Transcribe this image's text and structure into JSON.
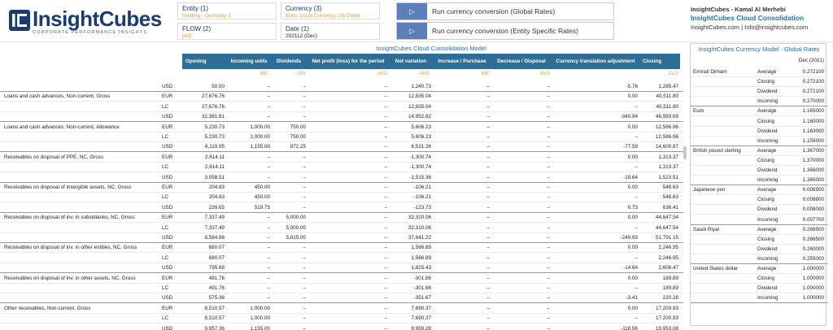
{
  "logo": {
    "main": "InsightCubes",
    "sub": "CORPORATE PERFORMANCE INSIGHTS"
  },
  "filters": [
    {
      "title": "Entity (1)",
      "value": "Holding - Germany 1"
    },
    {
      "title": "Currency (3)",
      "value": "Euro, Local Currency, US Dollar"
    },
    {
      "title": "FLOW (2)",
      "value": "[All]"
    },
    {
      "title": "Date (1)",
      "value": "202112 (Dec)"
    }
  ],
  "buttons": [
    {
      "label": "Run currency conversion (Global Rates)"
    },
    {
      "label": "Run currency conversion (Entity Specific Rates)"
    }
  ],
  "info": {
    "line1": "InsightCubes - Kamal Al Merhebi",
    "line2": "InsightCubes Cloud Consolidation",
    "line3": "InsightCubes.com | Info@insightcubes.com"
  },
  "main": {
    "title": "InsightCubes Cloud Consolidation Model",
    "columns": [
      "Opening",
      "Incoming units",
      "Dividends",
      "Net profit (loss) for the period",
      "Net variation",
      "Increase / Purchase",
      "Decrease / Disposal",
      "Currency translation adjustment",
      "Closing"
    ],
    "operators": [
      "",
      "INC",
      "DIV",
      "AVG",
      "AVG",
      "INC",
      "AVG",
      "",
      "CLO"
    ],
    "rows": [
      {
        "label": "",
        "cur": "USD",
        "v": [
          "50.50",
          "–",
          "–",
          "–",
          "1,240.73",
          "–",
          "–",
          "-5.76",
          "1,285.47"
        ]
      },
      {
        "label": "Loans and cash advances, Non-current, Gross",
        "cur": "EUR",
        "v": [
          "27,676.76",
          "–",
          "–",
          "–",
          "12,835.04",
          "–",
          "–",
          "0.00",
          "40,511.80"
        ]
      },
      {
        "label": "",
        "cur": "LC",
        "v": [
          "27,676.76",
          "–",
          "–",
          "–",
          "12,835.04",
          "–",
          "–",
          "–",
          "40,511.80"
        ]
      },
      {
        "label": "",
        "cur": "USD",
        "v": [
          "32,381.81",
          "–",
          "–",
          "–",
          "14,952.82",
          "–",
          "–",
          "-340.94",
          "46,993.69"
        ]
      },
      {
        "label": "Loans and cash advances, Non-current, Allowance",
        "cur": "EUR",
        "v": [
          "5,230.73",
          "1,000.00",
          "750.00",
          "–",
          "5,606.23",
          "–",
          "–",
          "0.00",
          "12,586.96"
        ]
      },
      {
        "label": "",
        "cur": "LC",
        "v": [
          "5,230.73",
          "1,000.00",
          "750.00",
          "–",
          "5,606.23",
          "–",
          "–",
          "–",
          "12,586.96"
        ]
      },
      {
        "label": "",
        "cur": "USD",
        "v": [
          "6,119.95",
          "1,155.00",
          "872.25",
          "–",
          "6,531.26",
          "–",
          "–",
          "-77.59",
          "14,600.87"
        ]
      },
      {
        "label": "Receivables on disposal of PPE, NC, Gross",
        "cur": "EUR",
        "v": [
          "2,614.11",
          "–",
          "–",
          "–",
          "-1,300.74",
          "–",
          "–",
          "0.00",
          "1,313.37"
        ]
      },
      {
        "label": "",
        "cur": "LC",
        "v": [
          "2,614.11",
          "–",
          "–",
          "–",
          "-1,300.74",
          "–",
          "–",
          "–",
          "1,313.37"
        ]
      },
      {
        "label": "",
        "cur": "USD",
        "v": [
          "3,058.51",
          "–",
          "–",
          "–",
          "-1,515.36",
          "–",
          "–",
          "-19.64",
          "1,523.51"
        ]
      },
      {
        "label": "Receivables on disposal of intangible assets, NC, Gross",
        "cur": "EUR",
        "v": [
          "204.83",
          "450.00",
          "–",
          "–",
          "-106.21",
          "–",
          "–",
          "0.00",
          "548.63"
        ]
      },
      {
        "label": "",
        "cur": "LC",
        "v": [
          "204.83",
          "450.00",
          "–",
          "–",
          "-106.21",
          "–",
          "–",
          "–",
          "548.63"
        ]
      },
      {
        "label": "",
        "cur": "USD",
        "v": [
          "239.65",
          "519.75",
          "–",
          "–",
          "-123.73",
          "–",
          "–",
          "0.73",
          "636.41"
        ]
      },
      {
        "label": "Receivables on disposal of inv. in subsidiaries, NC, Gross",
        "cur": "EUR",
        "v": [
          "7,337.49",
          "–",
          "5,000.00",
          "–",
          "32,310.06",
          "–",
          "–",
          "0.00",
          "44,647.54"
        ]
      },
      {
        "label": "",
        "cur": "LC",
        "v": [
          "7,337.49",
          "–",
          "5,000.00",
          "–",
          "32,310.06",
          "–",
          "–",
          "–",
          "44,647.54"
        ]
      },
      {
        "label": "",
        "cur": "USD",
        "v": [
          "8,584.86",
          "–",
          "5,815.00",
          "–",
          "37,641.22",
          "–",
          "–",
          "-249.93",
          "51,791.15"
        ]
      },
      {
        "label": "Receivables on disposal of inv. in other entities, NC, Gross",
        "cur": "EUR",
        "v": [
          "680.07",
          "–",
          "–",
          "–",
          "1,566.89",
          "–",
          "–",
          "0.00",
          "2,246.95"
        ]
      },
      {
        "label": "",
        "cur": "LC",
        "v": [
          "680.07",
          "–",
          "–",
          "–",
          "1,566.89",
          "–",
          "–",
          "–",
          "2,246.95"
        ]
      },
      {
        "label": "",
        "cur": "USD",
        "v": [
          "795.68",
          "–",
          "–",
          "–",
          "1,825.43",
          "–",
          "–",
          "-14.64",
          "2,606.47"
        ]
      },
      {
        "label": "Receivables on disposal of inv. in other assets, NC, Gross",
        "cur": "EUR",
        "v": [
          "491.76",
          "–",
          "–",
          "–",
          "-301.86",
          "–",
          "–",
          "0.00",
          "189.89"
        ]
      },
      {
        "label": "",
        "cur": "LC",
        "v": [
          "491.76",
          "–",
          "–",
          "–",
          "-301.86",
          "–",
          "–",
          "–",
          "189.89"
        ]
      },
      {
        "label": "",
        "cur": "USD",
        "v": [
          "575.36",
          "–",
          "–",
          "–",
          "-351.67",
          "–",
          "–",
          "-3.41",
          "220.28"
        ]
      },
      {
        "label": "Other receivables, Non-current, Gross",
        "cur": "EUR",
        "v": [
          "8,510.57",
          "1,000.00",
          "–",
          "–",
          "7,690.37",
          "–",
          "–",
          "0.00",
          "17,200.93"
        ]
      },
      {
        "label": "",
        "cur": "LC",
        "v": [
          "8,510.57",
          "1,000.00",
          "–",
          "–",
          "7,690.37",
          "–",
          "–",
          "–",
          "17,200.93"
        ]
      },
      {
        "label": "",
        "cur": "USD",
        "v": [
          "9,957.36",
          "1,155.00",
          "–",
          "–",
          "8,959.28",
          "–",
          "–",
          "-118.56",
          "19,953.08"
        ]
      }
    ]
  },
  "rates": {
    "title": "InsightCubes Currency Model - Global Rates",
    "date": "Dec (2021)",
    "groups": [
      {
        "currency": "Emirati Dirham",
        "items": [
          [
            "Average",
            "0.272100"
          ],
          [
            "Closing",
            "0.272100"
          ],
          [
            "Dividend",
            "0.272100"
          ],
          [
            "Incoming",
            "0.270000"
          ]
        ]
      },
      {
        "currency": "Euro",
        "items": [
          [
            "Average",
            "1.165000"
          ],
          [
            "Closing",
            "1.160000"
          ],
          [
            "Dividend",
            "1.163000"
          ],
          [
            "Incoming",
            "1.155000"
          ]
        ]
      },
      {
        "currency": "British pound sterling",
        "items": [
          [
            "Average",
            "1.367000"
          ],
          [
            "Closing",
            "1.370000"
          ],
          [
            "Dividend",
            "1.366000"
          ],
          [
            "Incoming",
            "1.365000"
          ]
        ]
      },
      {
        "currency": "Japanese yen",
        "items": [
          [
            "Average",
            "0.008500"
          ],
          [
            "Closing",
            "0.008800"
          ],
          [
            "Dividend",
            "0.008000"
          ],
          [
            "Incoming",
            "0.007700"
          ]
        ]
      },
      {
        "currency": "Saudi Riyal",
        "items": [
          [
            "Average",
            "0.266500"
          ],
          [
            "Closing",
            "0.266500"
          ],
          [
            "Dividend",
            "0.260000"
          ],
          [
            "Incoming",
            "0.255000"
          ]
        ]
      },
      {
        "currency": "United States dollar",
        "items": [
          [
            "Average",
            "1.000000"
          ],
          [
            "Closing",
            "1.000000"
          ],
          [
            "Dividend",
            "1.000000"
          ],
          [
            "Incoming",
            "1.000000"
          ]
        ]
      }
    ]
  }
}
